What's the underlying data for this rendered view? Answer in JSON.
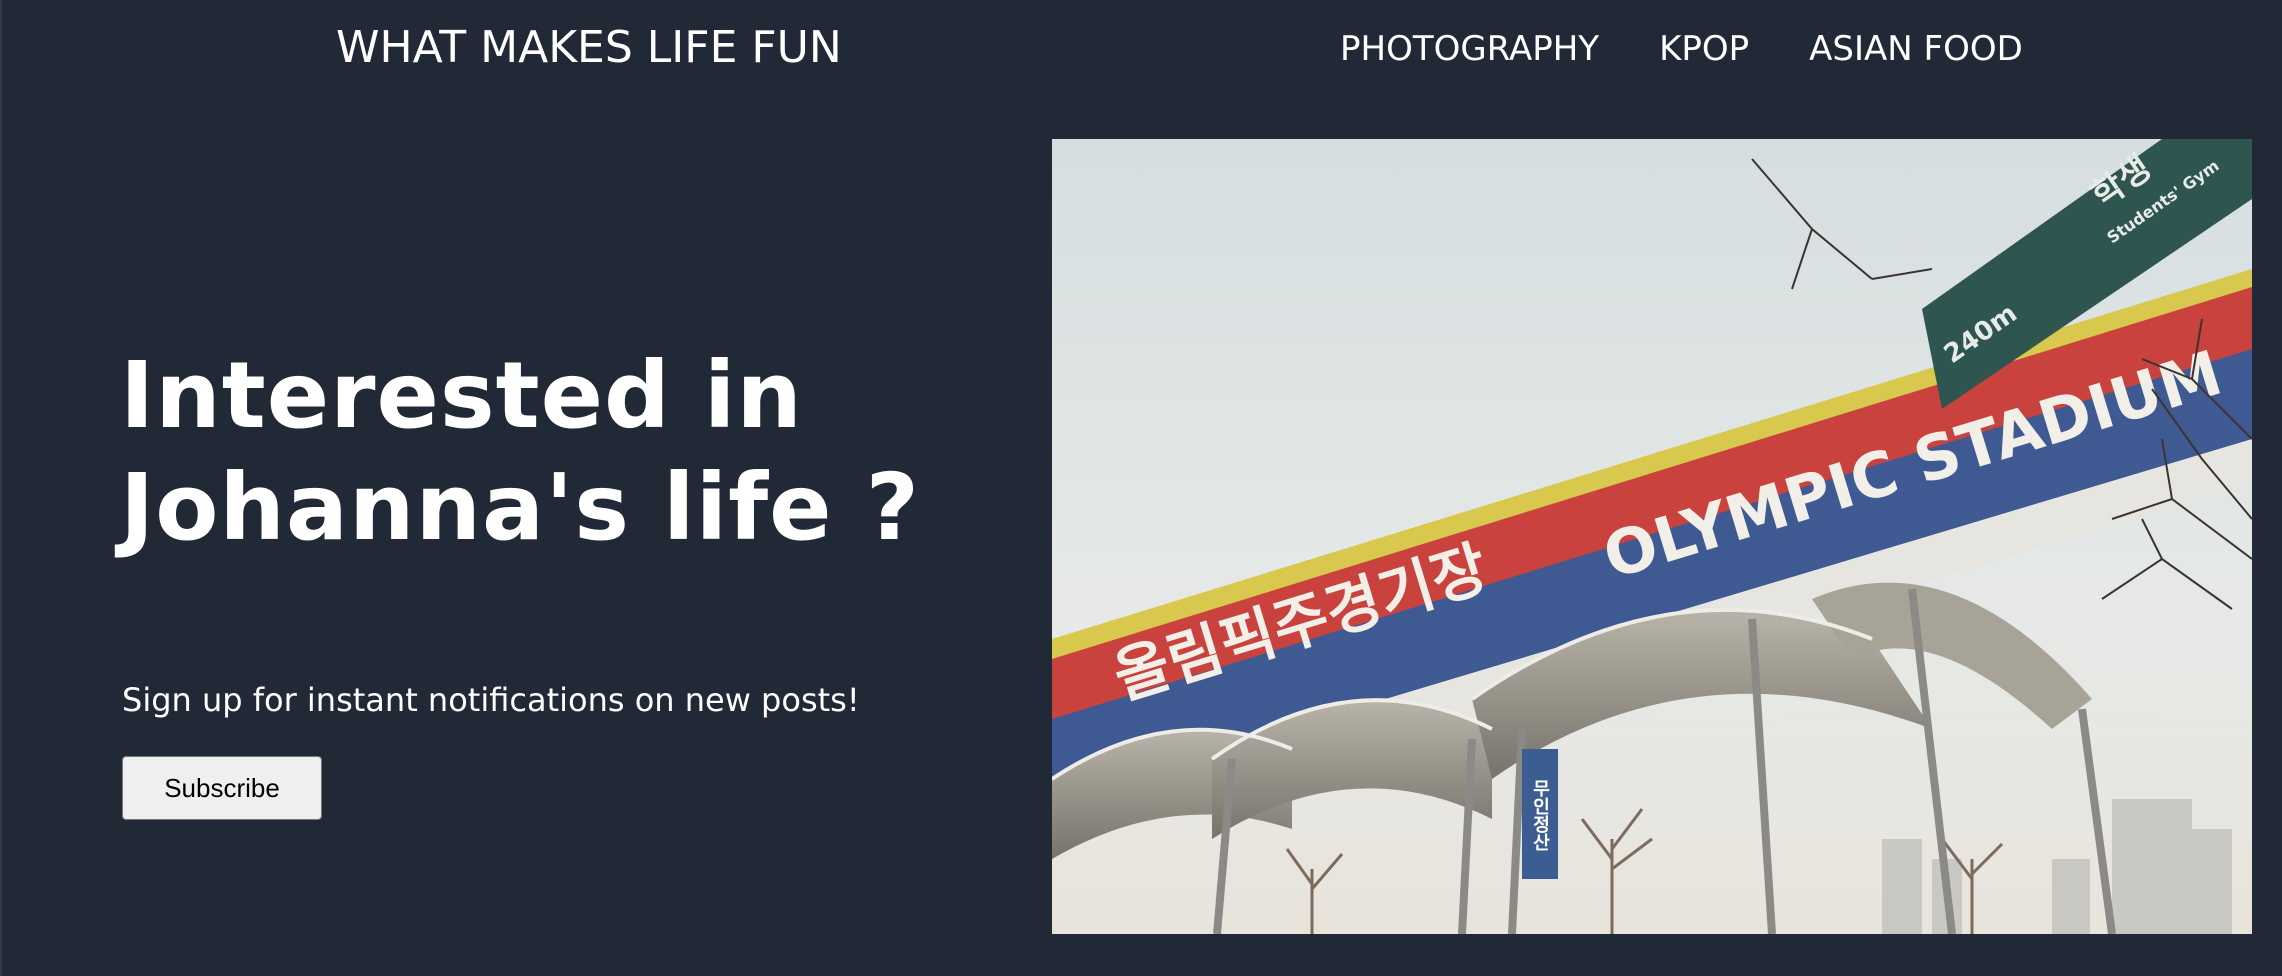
{
  "header": {
    "site_title": "WHAT MAKES LIFE FUN",
    "nav": [
      {
        "label": "PHOTOGRAPHY"
      },
      {
        "label": "KPOP"
      },
      {
        "label": "ASIAN FOOD"
      }
    ]
  },
  "hero": {
    "heading_line1": "Interested in",
    "heading_line2": "Johanna's life ?",
    "signup_text": "Sign up for instant notifications on new posts!",
    "subscribe_label": "Subscribe"
  },
  "photo": {
    "banner_english": "OLYMPIC STADIUM",
    "banner_korean": "올림픽주경기장",
    "sign_distance": "240m",
    "sign_korean": "학생",
    "sign_english": "Students' Gym",
    "pole_sign": "무인정산"
  },
  "colors": {
    "background": "#212836",
    "text": "#ffffff",
    "button_bg": "#efefef"
  }
}
